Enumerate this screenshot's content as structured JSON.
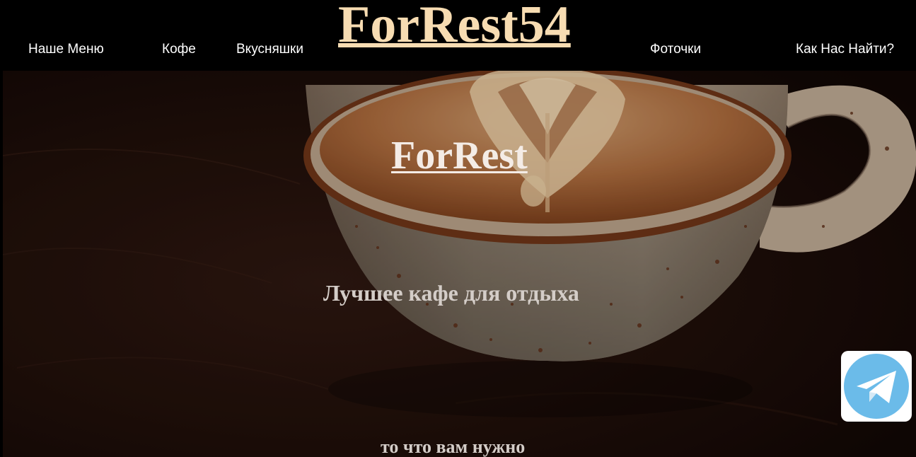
{
  "header": {
    "logo": "ForRest54",
    "nav": {
      "menu": "Наше Меню",
      "coffee": "Кофе",
      "snacks": "Вкусняшки",
      "photos": "Фоточки",
      "find_us": "Как Нас Найти?"
    }
  },
  "hero": {
    "title": "ForRest",
    "tagline": "Лучшее кафе для отдыха",
    "subtitle": "то что вам нужно",
    "image": "coffee-cup-latte-art-photo"
  },
  "floating": {
    "telegram_icon": "telegram-icon"
  },
  "colors": {
    "header_bg": "#000000",
    "logo": "#f7dcb2",
    "nav_text": "#ffffff",
    "hero_text": "#d4cdc8",
    "telegram_blue": "#6bbbe9"
  }
}
